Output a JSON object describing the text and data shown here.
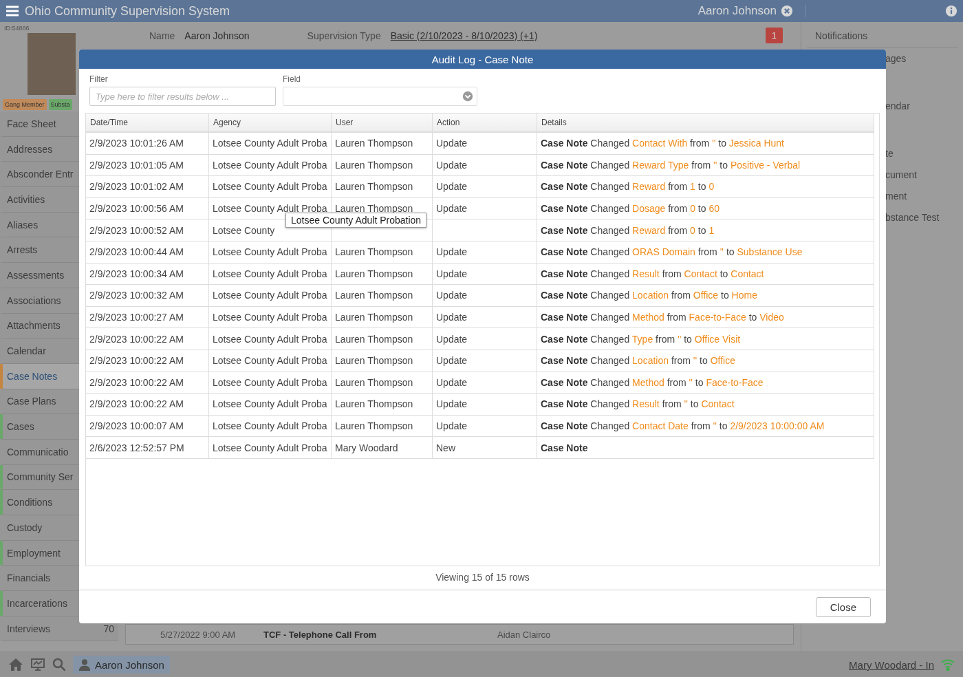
{
  "app_bar": {
    "title": "Ohio Community Supervision System",
    "open_record": "Aaron Johnson"
  },
  "profile": {
    "id": "ID:54886",
    "tags": [
      {
        "label": "Gang Member",
        "color": "#c08a5a"
      },
      {
        "label": "Substa",
        "color": "#6aa86a"
      }
    ],
    "name_label": "Name",
    "name": "Aaron Johnson",
    "supervision_label": "Supervision Type",
    "supervision": "Basic (2/10/2023 - 8/10/2023) (+1)",
    "alert_count": "1"
  },
  "sidebar": {
    "items": [
      {
        "label": "Face Sheet",
        "selected": false
      },
      {
        "label": "Addresses",
        "selected": false
      },
      {
        "label": "Absconder Entr",
        "selected": false
      },
      {
        "label": "Activities",
        "selected": false
      },
      {
        "label": "Aliases",
        "selected": false
      },
      {
        "label": "Arrests",
        "selected": false
      },
      {
        "label": "Assessments",
        "selected": false
      },
      {
        "label": "Associations",
        "selected": false
      },
      {
        "label": "Attachments",
        "selected": false
      },
      {
        "label": "Calendar",
        "selected": false
      },
      {
        "label": "Case Notes",
        "selected": true,
        "color": "#c48540"
      },
      {
        "label": "Case Plans",
        "selected": false
      },
      {
        "label": "Cases",
        "selected": false,
        "color": "#6aa86a"
      },
      {
        "label": "Communicatio",
        "selected": false
      },
      {
        "label": "Community Ser",
        "selected": false,
        "color": "#6aa86a"
      },
      {
        "label": "Conditions",
        "selected": false,
        "color": "#6aa86a"
      },
      {
        "label": "Custody",
        "selected": false
      },
      {
        "label": "Employment",
        "selected": false,
        "color": "#6aa86a"
      },
      {
        "label": "Financials",
        "selected": false
      },
      {
        "label": "Incarcerations",
        "selected": false,
        "color": "#6aa86a"
      },
      {
        "label": "Interviews",
        "selected": false,
        "count": "70"
      }
    ]
  },
  "background_row": {
    "date": "5/27/2022 9:00 AM",
    "type": "TCF - Telephone Call From",
    "officer": "Aidan Clairco"
  },
  "right_panel": {
    "title": "Notifications",
    "items": [
      "ages",
      "endar",
      "te",
      "cument",
      "ment",
      "bstance Test"
    ]
  },
  "modal": {
    "title": "Audit Log - Case Note",
    "filter_label": "Filter",
    "filter_placeholder": "Type here to filter results below ...",
    "field_label": "Field",
    "columns": [
      "Date/Time",
      "Agency",
      "User",
      "Action",
      "Details"
    ],
    "rows": [
      {
        "date": "2/9/2023 10:01:26 AM",
        "agency": "Lotsee County Adult Proba",
        "user": "Lauren Thompson",
        "action": "Update",
        "details": [
          {
            "kind": "entity",
            "text": "Case Note"
          },
          {
            "kind": "plain",
            "text": "Changed"
          },
          {
            "kind": "value",
            "text": "Contact With"
          },
          {
            "kind": "plain",
            "text": "from"
          },
          {
            "kind": "value",
            "text": "''"
          },
          {
            "kind": "plain",
            "text": "to"
          },
          {
            "kind": "value",
            "text": "Jessica Hunt"
          }
        ]
      },
      {
        "date": "2/9/2023 10:01:05 AM",
        "agency": "Lotsee County Adult Proba",
        "user": "Lauren Thompson",
        "action": "Update",
        "details": [
          {
            "kind": "entity",
            "text": "Case Note"
          },
          {
            "kind": "plain",
            "text": "Changed"
          },
          {
            "kind": "value",
            "text": "Reward Type"
          },
          {
            "kind": "plain",
            "text": "from"
          },
          {
            "kind": "value",
            "text": "''"
          },
          {
            "kind": "plain",
            "text": "to"
          },
          {
            "kind": "value",
            "text": "Positive - Verbal"
          }
        ]
      },
      {
        "date": "2/9/2023 10:01:02 AM",
        "agency": "Lotsee County Adult Proba",
        "user": "Lauren Thompson",
        "action": "Update",
        "details": [
          {
            "kind": "entity",
            "text": "Case Note"
          },
          {
            "kind": "plain",
            "text": "Changed"
          },
          {
            "kind": "value",
            "text": "Reward"
          },
          {
            "kind": "plain",
            "text": "from"
          },
          {
            "kind": "value",
            "text": "1"
          },
          {
            "kind": "plain",
            "text": "to"
          },
          {
            "kind": "value",
            "text": "0"
          }
        ]
      },
      {
        "date": "2/9/2023 10:00:56 AM",
        "agency": "Lotsee County Adult Proba",
        "user": "Lauren Thompson",
        "action": "Update",
        "details": [
          {
            "kind": "entity",
            "text": "Case Note"
          },
          {
            "kind": "plain",
            "text": "Changed"
          },
          {
            "kind": "value",
            "text": "Dosage"
          },
          {
            "kind": "plain",
            "text": "from"
          },
          {
            "kind": "value",
            "text": "0"
          },
          {
            "kind": "plain",
            "text": "to"
          },
          {
            "kind": "value",
            "text": "60"
          }
        ]
      },
      {
        "date": "2/9/2023 10:00:52 AM",
        "agency": "Lotsee County",
        "details": [
          {
            "kind": "entity",
            "text": "Case Note"
          },
          {
            "kind": "plain",
            "text": "Changed"
          },
          {
            "kind": "value",
            "text": "Reward"
          },
          {
            "kind": "plain",
            "text": "from"
          },
          {
            "kind": "value",
            "text": "0"
          },
          {
            "kind": "plain",
            "text": "to"
          },
          {
            "kind": "value",
            "text": "1"
          }
        ]
      },
      {
        "date": "2/9/2023 10:00:44 AM",
        "agency": "Lotsee County Adult Proba",
        "user": "Lauren Thompson",
        "action": "Update",
        "details": [
          {
            "kind": "entity",
            "text": "Case Note"
          },
          {
            "kind": "plain",
            "text": "Changed"
          },
          {
            "kind": "value",
            "text": "ORAS Domain"
          },
          {
            "kind": "plain",
            "text": "from"
          },
          {
            "kind": "value",
            "text": "''"
          },
          {
            "kind": "plain",
            "text": "to"
          },
          {
            "kind": "value",
            "text": "Substance Use"
          }
        ]
      },
      {
        "date": "2/9/2023 10:00:34 AM",
        "agency": "Lotsee County Adult Proba",
        "user": "Lauren Thompson",
        "action": "Update",
        "details": [
          {
            "kind": "entity",
            "text": "Case Note"
          },
          {
            "kind": "plain",
            "text": "Changed"
          },
          {
            "kind": "value",
            "text": "Result"
          },
          {
            "kind": "plain",
            "text": "from"
          },
          {
            "kind": "value",
            "text": "Contact"
          },
          {
            "kind": "plain",
            "text": "to"
          },
          {
            "kind": "value",
            "text": "Contact"
          }
        ]
      },
      {
        "date": "2/9/2023 10:00:32 AM",
        "agency": "Lotsee County Adult Proba",
        "user": "Lauren Thompson",
        "action": "Update",
        "details": [
          {
            "kind": "entity",
            "text": "Case Note"
          },
          {
            "kind": "plain",
            "text": "Changed"
          },
          {
            "kind": "value",
            "text": "Location"
          },
          {
            "kind": "plain",
            "text": "from"
          },
          {
            "kind": "value",
            "text": "Office"
          },
          {
            "kind": "plain",
            "text": "to"
          },
          {
            "kind": "value",
            "text": "Home"
          }
        ]
      },
      {
        "date": "2/9/2023 10:00:27 AM",
        "agency": "Lotsee County Adult Proba",
        "user": "Lauren Thompson",
        "action": "Update",
        "details": [
          {
            "kind": "entity",
            "text": "Case Note"
          },
          {
            "kind": "plain",
            "text": "Changed"
          },
          {
            "kind": "value",
            "text": "Method"
          },
          {
            "kind": "plain",
            "text": "from"
          },
          {
            "kind": "value",
            "text": "Face-to-Face"
          },
          {
            "kind": "plain",
            "text": "to"
          },
          {
            "kind": "value",
            "text": "Video"
          }
        ]
      },
      {
        "date": "2/9/2023 10:00:22 AM",
        "agency": "Lotsee County Adult Proba",
        "user": "Lauren Thompson",
        "action": "Update",
        "details": [
          {
            "kind": "entity",
            "text": "Case Note"
          },
          {
            "kind": "plain",
            "text": "Changed"
          },
          {
            "kind": "value",
            "text": "Type"
          },
          {
            "kind": "plain",
            "text": "from"
          },
          {
            "kind": "value",
            "text": "''"
          },
          {
            "kind": "plain",
            "text": "to"
          },
          {
            "kind": "value",
            "text": "Office Visit"
          }
        ]
      },
      {
        "date": "2/9/2023 10:00:22 AM",
        "agency": "Lotsee County Adult Proba",
        "user": "Lauren Thompson",
        "action": "Update",
        "details": [
          {
            "kind": "entity",
            "text": "Case Note"
          },
          {
            "kind": "plain",
            "text": "Changed"
          },
          {
            "kind": "value",
            "text": "Location"
          },
          {
            "kind": "plain",
            "text": "from"
          },
          {
            "kind": "value",
            "text": "''"
          },
          {
            "kind": "plain",
            "text": "to"
          },
          {
            "kind": "value",
            "text": "Office"
          }
        ]
      },
      {
        "date": "2/9/2023 10:00:22 AM",
        "agency": "Lotsee County Adult Proba",
        "user": "Lauren Thompson",
        "action": "Update",
        "details": [
          {
            "kind": "entity",
            "text": "Case Note"
          },
          {
            "kind": "plain",
            "text": "Changed"
          },
          {
            "kind": "value",
            "text": "Method"
          },
          {
            "kind": "plain",
            "text": "from"
          },
          {
            "kind": "value",
            "text": "''"
          },
          {
            "kind": "plain",
            "text": "to"
          },
          {
            "kind": "value",
            "text": "Face-to-Face"
          }
        ]
      },
      {
        "date": "2/9/2023 10:00:22 AM",
        "agency": "Lotsee County Adult Proba",
        "user": "Lauren Thompson",
        "action": "Update",
        "details": [
          {
            "kind": "entity",
            "text": "Case Note"
          },
          {
            "kind": "plain",
            "text": "Changed"
          },
          {
            "kind": "value",
            "text": "Result"
          },
          {
            "kind": "plain",
            "text": "from"
          },
          {
            "kind": "value",
            "text": "''"
          },
          {
            "kind": "plain",
            "text": "to"
          },
          {
            "kind": "value",
            "text": "Contact"
          }
        ]
      },
      {
        "date": "2/9/2023 10:00:07 AM",
        "agency": "Lotsee County Adult Proba",
        "user": "Lauren Thompson",
        "action": "Update",
        "details": [
          {
            "kind": "entity",
            "text": "Case Note"
          },
          {
            "kind": "plain",
            "text": "Changed"
          },
          {
            "kind": "value",
            "text": "Contact Date"
          },
          {
            "kind": "plain",
            "text": "from"
          },
          {
            "kind": "value",
            "text": "''"
          },
          {
            "kind": "plain",
            "text": "to"
          },
          {
            "kind": "value",
            "text": "2/9/2023 10:00:00 AM"
          }
        ]
      },
      {
        "date": "2/6/2023 12:52:57 PM",
        "agency": "Lotsee County Adult Proba",
        "user": "Mary Woodard",
        "action": "New",
        "details": [
          {
            "kind": "entity",
            "text": "Case Note"
          }
        ]
      }
    ],
    "tooltip": "Lotsee County Adult Probation",
    "footer": "Viewing 15 of 15 rows",
    "close_button": "Close"
  },
  "taskbar": {
    "tab": "Aaron Johnson",
    "user_status": "Mary Woodard - In"
  }
}
